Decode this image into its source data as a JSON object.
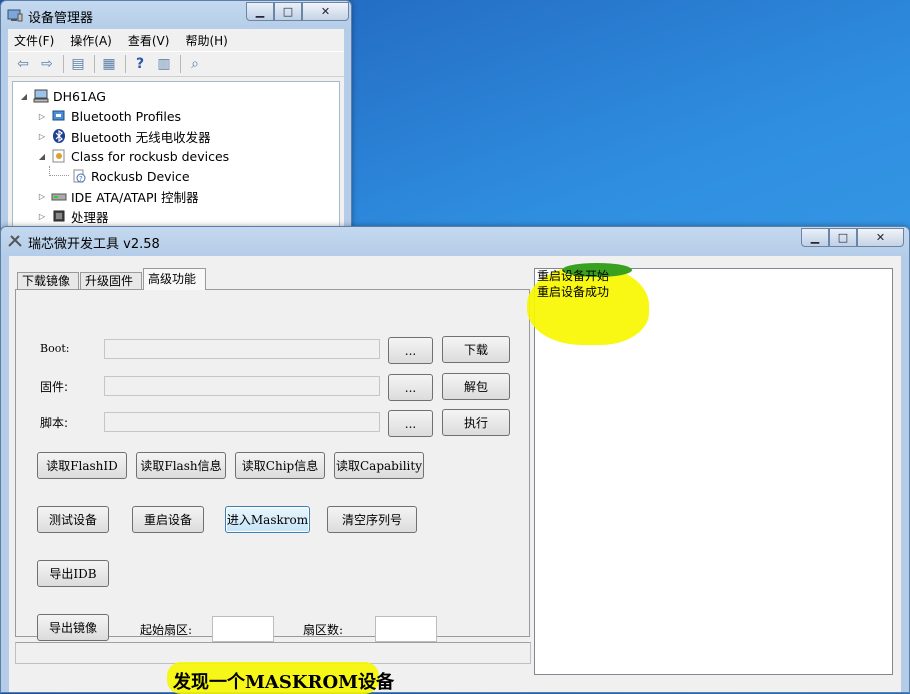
{
  "device_manager": {
    "title": "设备管理器",
    "caption": {
      "minimize": "▁",
      "maximize": "□",
      "close": "✕"
    },
    "menu": [
      "文件(F)",
      "操作(A)",
      "查看(V)",
      "帮助(H)"
    ],
    "toolbar_icons": [
      "back-icon",
      "forward-icon",
      "console-tree-icon",
      "properties-icon",
      "help-icon",
      "view-icon",
      "scan-hardware-icon"
    ],
    "tree": {
      "root": "DH61AG",
      "items": [
        {
          "label": "Bluetooth Profiles",
          "expander": "▷"
        },
        {
          "label": "Bluetooth 无线电收发器",
          "expander": "▷"
        },
        {
          "label": "Class for rockusb devices",
          "expander": "◢"
        },
        {
          "label": "Rockusb Device",
          "expander": ""
        },
        {
          "label": "IDE ATA/ATAPI 控制器",
          "expander": "▷"
        },
        {
          "label": "处理器",
          "expander": "▷"
        }
      ],
      "root_expander": "◢"
    }
  },
  "rk_tool": {
    "title": "瑞芯微开发工具 v2.58",
    "caption": {
      "minimize": "▁",
      "maximize": "□",
      "close": "✕"
    },
    "tabs": [
      "下载镜像",
      "升级固件",
      "高级功能"
    ],
    "active_tab": 2,
    "rows": {
      "boot_label": "Boot:",
      "firmware_label": "固件:",
      "script_label": "脚本:",
      "browse": "...",
      "download": "下载",
      "unpack": "解包",
      "execute": "执行"
    },
    "read_buttons": [
      "读取FlashID",
      "读取Flash信息",
      "读取Chip信息",
      "读取Capability"
    ],
    "device_buttons": [
      "测试设备",
      "重启设备",
      "进入Maskrom",
      "清空序列号"
    ],
    "export_idb": "导出IDB",
    "export_image": "导出镜像",
    "start_sector_label": "起始扇区:",
    "sector_count_label": "扇区数:",
    "status": "发现一个MASKROM设备",
    "log": [
      "重启设备开始",
      "重启设备成功"
    ]
  },
  "colors": {
    "desktop": "#2a7fd0",
    "highlight": "#f7f700",
    "window_frame": "#b4cce8"
  }
}
